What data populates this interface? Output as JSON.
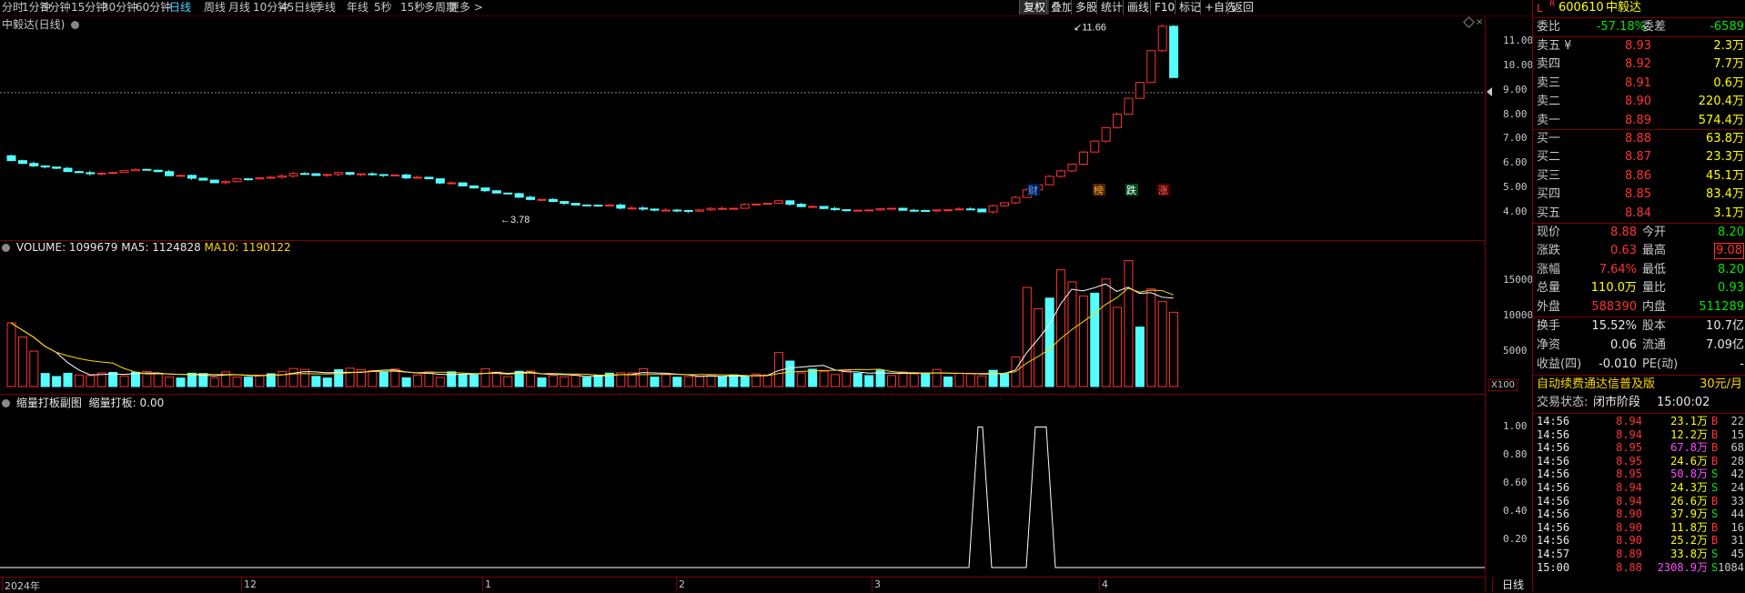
{
  "toolbar": {
    "periods": [
      "分时",
      "1分钟",
      "5分钟",
      "15分钟",
      "30分钟",
      "60分钟",
      "日线",
      "周线",
      "月线",
      "10分钟",
      "45日线",
      "季线",
      "年线",
      "5秒",
      "15秒",
      "多周期",
      "更多 >"
    ],
    "active_period": "日线",
    "tools": [
      "复权",
      "叠加",
      "多股",
      "统计",
      "画线",
      "F10",
      "标记",
      "+自选",
      "返回"
    ],
    "active_tool": "复权"
  },
  "main": {
    "title": "中毅达(日线)",
    "high_label": "11.66",
    "low_label": "3.78",
    "y_ticks": [
      "11.00",
      "10.00",
      "9.00",
      "8.00",
      "7.00",
      "6.00",
      "5.00",
      "4.00"
    ],
    "markers": [
      "财",
      "榜",
      "跌",
      "涨"
    ],
    "current_price": "8.88"
  },
  "volume": {
    "label_vol": "VOLUME: 1099679",
    "label_ma5": "MA5: 1124828",
    "label_ma10": "MA10: 1190122",
    "y_ticks": [
      "15000",
      "10000",
      "5000"
    ],
    "unit": "X100"
  },
  "indicator": {
    "title": "缩量打板副图",
    "value_label": "缩量打板: 0.00",
    "y_ticks": [
      "1.00",
      "0.80",
      "0.60",
      "0.40",
      "0.20"
    ]
  },
  "xaxis": {
    "labels": [
      "2024年",
      "12",
      "1",
      "2",
      "3",
      "4"
    ],
    "period": "日线"
  },
  "colors": {
    "up": "#ff3232",
    "down": "#54ffff",
    "ma5": "#ffffff",
    "ma10": "#ffd700",
    "grid": "#7a0000"
  },
  "quote": {
    "code": "600610",
    "name": "中毅达",
    "flag": "L",
    "flag2": "R",
    "weibi_label": "委比",
    "weibi": "-57.18%",
    "weicha_label": "委差",
    "weicha": "-6589",
    "asks": [
      {
        "label": "卖五 ¥",
        "price": "8.93",
        "vol": "2.3万"
      },
      {
        "label": "卖四",
        "price": "8.92",
        "vol": "7.7万"
      },
      {
        "label": "卖三",
        "price": "8.91",
        "vol": "0.6万"
      },
      {
        "label": "卖二",
        "price": "8.90",
        "vol": "220.4万"
      },
      {
        "label": "卖一",
        "price": "8.89",
        "vol": "574.4万"
      }
    ],
    "bids": [
      {
        "label": "买一",
        "price": "8.88",
        "vol": "63.8万"
      },
      {
        "label": "买二",
        "price": "8.87",
        "vol": "23.3万"
      },
      {
        "label": "买三",
        "price": "8.86",
        "vol": "45.1万"
      },
      {
        "label": "买四",
        "price": "8.85",
        "vol": "83.4万"
      },
      {
        "label": "买五",
        "price": "8.84",
        "vol": "3.1万"
      }
    ],
    "stats": [
      {
        "l1": "现价",
        "v1": "8.88",
        "c1": "red",
        "l2": "今开",
        "v2": "8.20",
        "c2": "green"
      },
      {
        "l1": "涨跌",
        "v1": "0.63",
        "c1": "red",
        "l2": "最高",
        "v2": "9.08",
        "c2": "red",
        "box": true
      },
      {
        "l1": "涨幅",
        "v1": "7.64%",
        "c1": "red",
        "l2": "最低",
        "v2": "8.20",
        "c2": "green"
      },
      {
        "l1": "总量",
        "v1": "110.0万",
        "c1": "yellow",
        "l2": "量比",
        "v2": "0.93",
        "c2": "green"
      },
      {
        "l1": "外盘",
        "v1": "588390",
        "c1": "red",
        "l2": "内盘",
        "v2": "511289",
        "c2": "green"
      }
    ],
    "stats2": [
      {
        "l1": "换手",
        "v1": "15.52%",
        "l2": "股本",
        "v2": "10.7亿"
      },
      {
        "l1": "净资",
        "v1": "0.06",
        "l2": "流通",
        "v2": "7.09亿"
      },
      {
        "l1": "收益(四)",
        "v1": "-0.010",
        "l2": "PE(动)",
        "v2": "-"
      }
    ],
    "promo": "自动续费通达信普及版",
    "promo_price": "30元/月",
    "status_label": "交易状态:",
    "status": "闭市阶段",
    "status_time": "15:00:02"
  },
  "ticks": [
    {
      "t": "14:56",
      "p": "8.94",
      "v": "23.1万",
      "bs": "B",
      "n": "22",
      "vc": "yellow"
    },
    {
      "t": "14:56",
      "p": "8.94",
      "v": "12.2万",
      "bs": "B",
      "n": "15",
      "vc": "yellow"
    },
    {
      "t": "14:56",
      "p": "8.95",
      "v": "67.8万",
      "bs": "B",
      "n": "68",
      "vc": "magenta"
    },
    {
      "t": "14:56",
      "p": "8.95",
      "v": "24.6万",
      "bs": "B",
      "n": "28",
      "vc": "yellow"
    },
    {
      "t": "14:56",
      "p": "8.95",
      "v": "50.8万",
      "bs": "S",
      "n": "42",
      "vc": "magenta"
    },
    {
      "t": "14:56",
      "p": "8.94",
      "v": "24.3万",
      "bs": "S",
      "n": "24",
      "vc": "yellow"
    },
    {
      "t": "14:56",
      "p": "8.94",
      "v": "26.6万",
      "bs": "B",
      "n": "33",
      "vc": "yellow"
    },
    {
      "t": "14:56",
      "p": "8.90",
      "v": "37.9万",
      "bs": "S",
      "n": "44",
      "vc": "yellow"
    },
    {
      "t": "14:56",
      "p": "8.90",
      "v": "11.8万",
      "bs": "B",
      "n": "16",
      "vc": "yellow"
    },
    {
      "t": "14:56",
      "p": "8.90",
      "v": "25.2万",
      "bs": "B",
      "n": "31",
      "vc": "yellow"
    },
    {
      "t": "14:57",
      "p": "8.89",
      "v": "33.8万",
      "bs": "S",
      "n": "45",
      "vc": "yellow"
    },
    {
      "t": "15:00",
      "p": "8.88",
      "v": "2308.9万",
      "bs": "S",
      "n": "1084",
      "vc": "magenta"
    }
  ],
  "chart_data": {
    "type": "candlestick",
    "x": [
      "2024年",
      "12",
      "1",
      "2",
      "3",
      "4"
    ],
    "close_approx": [
      6.0,
      5.6,
      5.6,
      5.5,
      5.3,
      5.1,
      5.1,
      5.0,
      4.6,
      4.4,
      4.2,
      4.0,
      3.9,
      4.3,
      4.2,
      4.0,
      4.0,
      4.1,
      4.0,
      4.0,
      4.0,
      4.4,
      5.1,
      6.0,
      7.5,
      9.0,
      11.6,
      8.9
    ],
    "ylim": [
      3.5,
      12.0
    ],
    "volume_ylim": [
      0,
      18000
    ],
    "indicator_series": [
      0,
      0,
      1,
      0,
      0,
      1,
      1,
      0,
      0
    ],
    "indicator_ylim": [
      0,
      1.1
    ]
  }
}
